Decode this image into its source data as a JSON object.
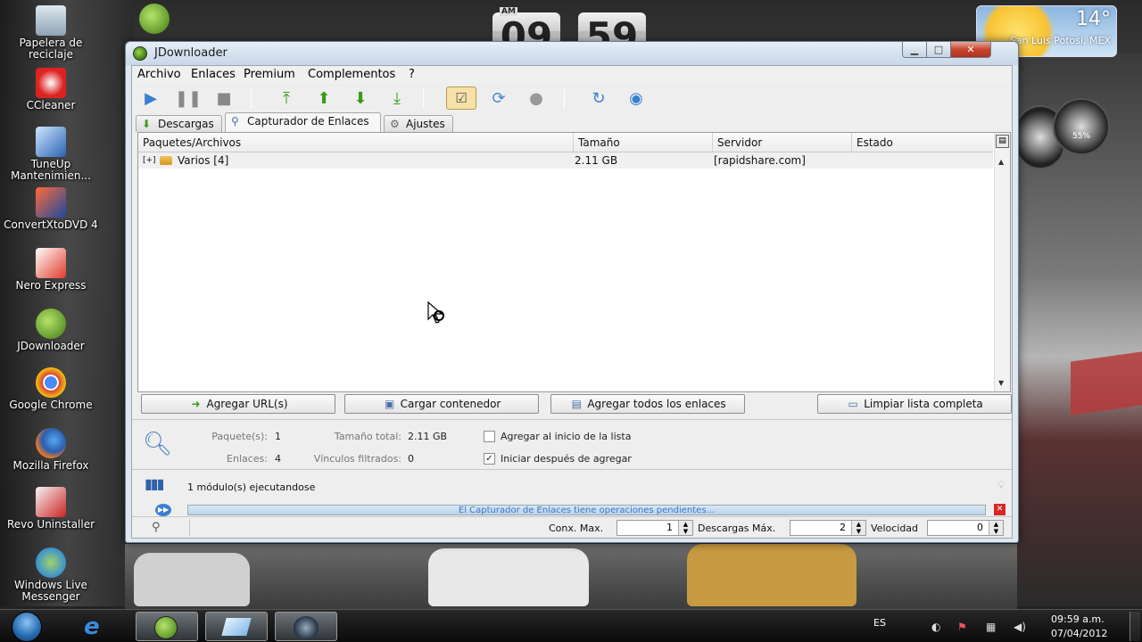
{
  "desktop": {
    "icons": [
      {
        "label": "Papelera de reciclaje"
      },
      {
        "label": "CCleaner"
      },
      {
        "label": "TuneUp Mantenimien..."
      },
      {
        "label": "ConvertXtoDVD 4"
      },
      {
        "label": "Nero Express"
      },
      {
        "label": "JDownloader"
      },
      {
        "label": "Google Chrome"
      },
      {
        "label": "Mozilla Firefox"
      },
      {
        "label": "Revo Uninstaller"
      },
      {
        "label": "Windows Live Messenger"
      }
    ]
  },
  "clock_gadget": {
    "ampm": "AM",
    "hour": "09",
    "minute": "59"
  },
  "weather_gadget": {
    "temp": "14°",
    "city": "San Luis Potosí, MEX"
  },
  "gauge": {
    "percent": "55%"
  },
  "window": {
    "title": "JDownloader",
    "controls": {
      "minimize": "▁",
      "maximize": "□",
      "close": "✕"
    }
  },
  "menu": [
    "Archivo",
    "Enlaces",
    "Premium",
    "Complementos",
    "?"
  ],
  "tabs": [
    {
      "label": "Descargas"
    },
    {
      "label": "Capturador de Enlaces"
    },
    {
      "label": "Ajustes"
    }
  ],
  "table": {
    "columns": [
      "Paquetes/Archivos",
      "Tamaño",
      "Servidor",
      "Estado"
    ],
    "rows": [
      {
        "expand": "[+]",
        "name": "Varios [4]",
        "size": "2.11 GB",
        "server": "[rapidshare.com]",
        "status": ""
      }
    ]
  },
  "actions": {
    "add_urls": "Agregar URL(s)",
    "load_container": "Cargar contenedor",
    "add_all": "Agregar todos los enlaces",
    "clear_list": "Limpiar lista completa"
  },
  "info": {
    "packages_label": "Paquete(s):",
    "packages_value": "1",
    "links_label": "Enlaces:",
    "links_value": "4",
    "total_size_label": "Tamaño total:",
    "total_size_value": "2.11 GB",
    "filtered_label": "Vínculos filtrados:",
    "filtered_value": "0",
    "add_top_label": "Agregar al inicio de la lista",
    "add_top_checked": false,
    "start_after_label": "Iniciar después de agregar",
    "start_after_checked": true
  },
  "status": {
    "modules": "1 módulo(s) ejecutandose",
    "pending": "El Capturador de Enlaces tiene operaciones pendientes..."
  },
  "bottom": {
    "max_conn_label": "Conx. Max.",
    "max_conn_value": "1",
    "max_downloads_label": "Descargas Máx.",
    "max_downloads_value": "2",
    "speed_label": "Velocidad",
    "speed_value": "0"
  },
  "taskbar": {
    "lang": "ES",
    "time": "09:59 a.m.",
    "date": "07/04/2012"
  },
  "colors": {
    "accent_green": "#3a9b1a",
    "link_blue": "#3b77c4",
    "close_red": "#c7452f"
  }
}
